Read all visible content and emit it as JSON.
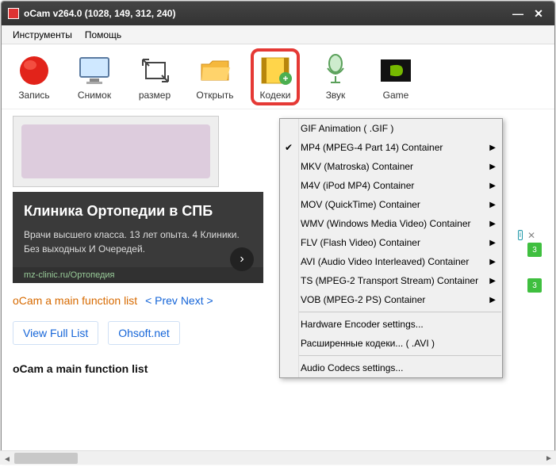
{
  "window": {
    "title": "oCam v264.0 (1028, 149, 312, 240)"
  },
  "menubar": {
    "instruments": "Инструменты",
    "help": "Помощь"
  },
  "toolbar": {
    "record": "Запись",
    "snapshot": "Снимок",
    "size": "размер",
    "open": "Открыть",
    "codecs": "Кодеки",
    "sound": "Звук",
    "game": "Game"
  },
  "codec_menu": [
    {
      "label": "GIF Animation ( .GIF )",
      "sub": false,
      "checked": false
    },
    {
      "label": "MP4 (MPEG-4 Part 14) Container",
      "sub": true,
      "checked": true
    },
    {
      "label": "MKV (Matroska) Container",
      "sub": true,
      "checked": false
    },
    {
      "label": "M4V (iPod MP4) Container",
      "sub": true,
      "checked": false
    },
    {
      "label": "MOV (QuickTime) Container",
      "sub": true,
      "checked": false
    },
    {
      "label": "WMV (Windows Media Video) Container",
      "sub": true,
      "checked": false
    },
    {
      "label": "FLV (Flash Video) Container",
      "sub": true,
      "checked": false
    },
    {
      "label": "AVI (Audio Video Interleaved) Container",
      "sub": true,
      "checked": false
    },
    {
      "label": "TS (MPEG-2 Transport Stream) Container",
      "sub": true,
      "checked": false
    },
    {
      "label": "VOB (MPEG-2 PS) Container",
      "sub": true,
      "checked": false
    },
    {
      "sep": true
    },
    {
      "label": "Hardware Encoder settings...",
      "sub": false,
      "checked": false
    },
    {
      "label": "Расширенные кодеки... ( .AVI )",
      "sub": false,
      "checked": false
    },
    {
      "sep": true
    },
    {
      "label": "Audio Codecs settings...",
      "sub": false,
      "checked": false
    }
  ],
  "ad": {
    "headline": "Клиника Ортопедии в СПБ",
    "body": "Врачи высшего класса. 13 лет опыта. 4 Клиники. Без выходных И Очередей.",
    "url": "mz-clinic.ru/Ортопедия"
  },
  "nav": {
    "list_label": "oCam a main function list",
    "prev_next": "< Prev Next >",
    "view_full": "View Full List",
    "ohsoft": "Ohsoft.net",
    "footer_heading": "oCam a main function list"
  },
  "badges": {
    "b1": "3",
    "b2": "3"
  },
  "adchoices": "i"
}
